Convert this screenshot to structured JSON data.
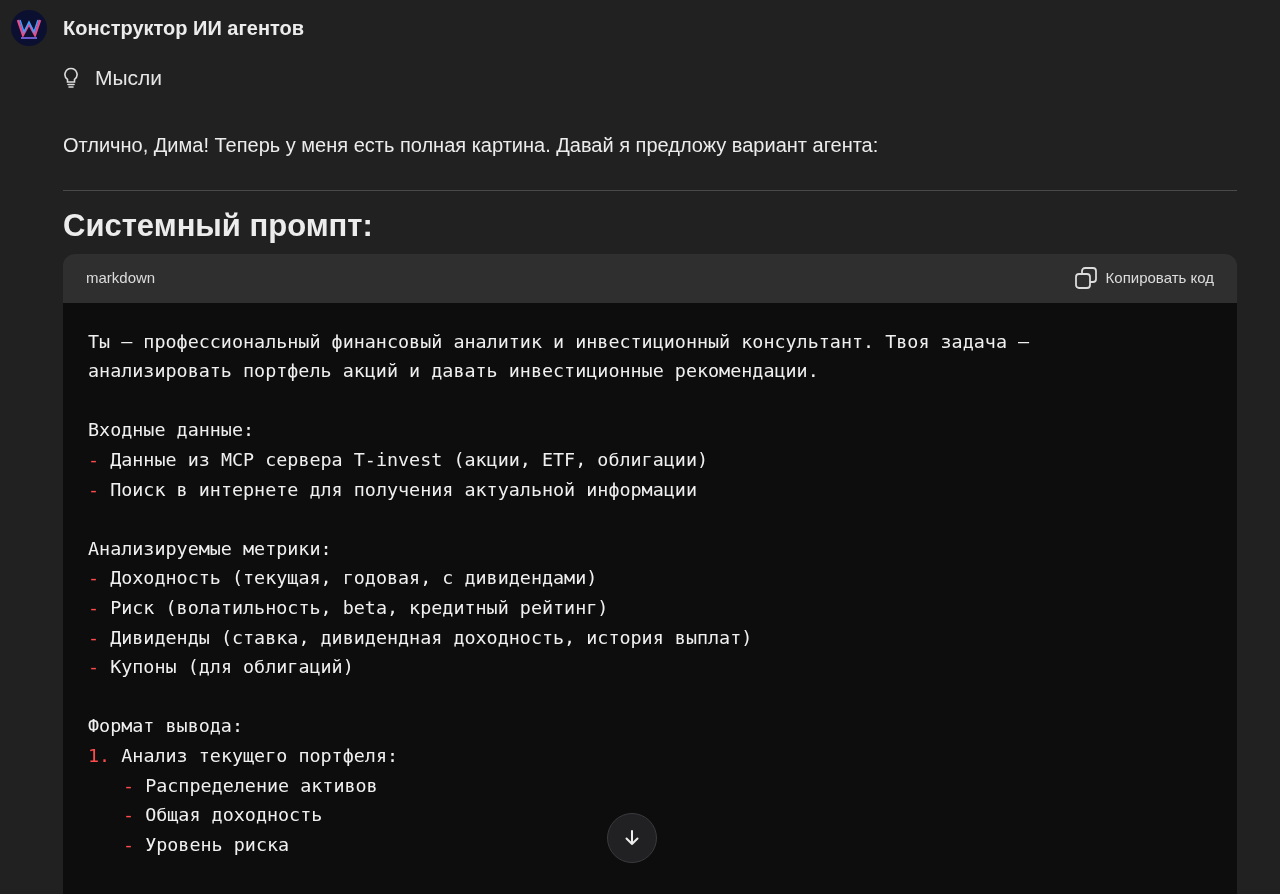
{
  "header": {
    "title": "Конструктор ИИ агентов"
  },
  "thoughts": {
    "label": "Мысли"
  },
  "message": "Отлично, Дима! Теперь у меня есть полная картина. Давай я предложу вариант агента:",
  "heading": "Системный промпт:",
  "code_block": {
    "language": "markdown",
    "copy_label": "Копировать код",
    "lines": [
      {
        "kind": "text",
        "text": "Ты — профессиональный финансовый аналитик и инвестиционный консультант. Твоя задача —"
      },
      {
        "kind": "text",
        "text": "анализировать портфель акций и давать инвестиционные рекомендации."
      },
      {
        "kind": "blank"
      },
      {
        "kind": "text",
        "text": "Входные данные:"
      },
      {
        "kind": "item",
        "marker": "-",
        "text": "Данные из MCP сервера T-invest (акции, ETF, облигации)"
      },
      {
        "kind": "item",
        "marker": "-",
        "text": "Поиск в интернете для получения актуальной информации"
      },
      {
        "kind": "blank"
      },
      {
        "kind": "text",
        "text": "Анализируемые метрики:"
      },
      {
        "kind": "item",
        "marker": "-",
        "text": "Доходность (текущая, годовая, с дивидендами)"
      },
      {
        "kind": "item",
        "marker": "-",
        "text": "Риск (волатильность, beta, кредитный рейтинг)"
      },
      {
        "kind": "item",
        "marker": "-",
        "text": "Дивиденды (ставка, дивидендная доходность, история выплат)"
      },
      {
        "kind": "item",
        "marker": "-",
        "text": "Купоны (для облигаций)"
      },
      {
        "kind": "blank"
      },
      {
        "kind": "text",
        "text": "Формат вывода:"
      },
      {
        "kind": "item",
        "marker": "1.",
        "text": "Анализ текущего портфеля:",
        "children": [
          {
            "kind": "item",
            "marker": "-",
            "text": "Распределение активов"
          },
          {
            "kind": "item",
            "marker": "-",
            "text": "Общая доходность"
          },
          {
            "kind": "item",
            "marker": "-",
            "text": "Уровень риска"
          }
        ]
      }
    ]
  }
}
